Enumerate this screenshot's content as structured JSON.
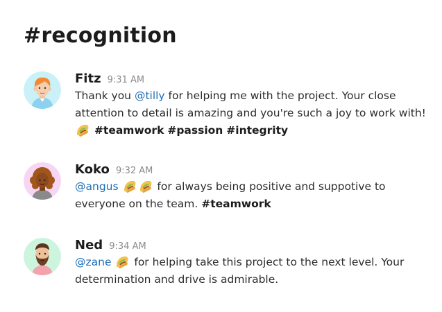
{
  "channel": {
    "title": "#recognition"
  },
  "messages": [
    {
      "author": "Fitz",
      "time": "9:31 AM",
      "avatar_icon": "redhead-man-avatar-icon",
      "avatar_bg": "#c9f1f7",
      "text_before_mention": "Thank you ",
      "mention": "@tilly",
      "text_line": " for helping me with the project. Your close attention to detail is amazing and you're such a joy to work with! ",
      "tacos": 1,
      "hashtags": [
        "#teamwork",
        "#passion",
        "#integrity"
      ]
    },
    {
      "author": "Koko",
      "time": "9:32 AM",
      "avatar_icon": "curly-hair-woman-avatar-icon",
      "avatar_bg": "#f7d6f3",
      "mention": "@angus",
      "tacos": 2,
      "text_line": " for always being positive and suppotive to everyone on the team. ",
      "hashtags": [
        "#teamwork"
      ]
    },
    {
      "author": "Ned",
      "time": "9:34 AM",
      "avatar_icon": "bearded-man-avatar-icon",
      "avatar_bg": "#cdf4dd",
      "mention": "@zane",
      "tacos": 1,
      "text_line": " for helping take this project to the next level. Your determination and drive is admirable."
    }
  ],
  "colors": {
    "mention": "#1e6fb4",
    "text": "#2b2b2b",
    "timestamp": "#8b8b8b"
  }
}
